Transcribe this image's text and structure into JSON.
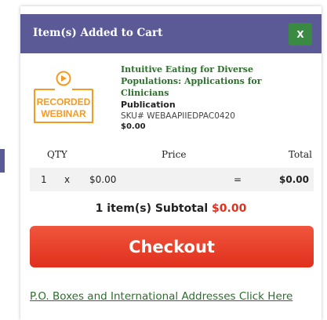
{
  "modal": {
    "title": "Item(s) Added to Cart",
    "close_label": "X"
  },
  "product": {
    "thumbnail_text": [
      "RECORDED",
      "WEBINAR"
    ],
    "thumbnail_icon": "play-circle-icon",
    "title": "Intuitive Eating for Diverse Populations: Applications for Clinicians",
    "type": "Publication",
    "sku": "SKU# WEBAAPIIEDPAC0420",
    "price": "$0.00"
  },
  "cart": {
    "headers": {
      "qty": "QTY",
      "price": "Price",
      "total": "Total"
    },
    "rows": [
      {
        "qty": "1",
        "times": "x",
        "price": "$0.00",
        "equals": "=",
        "total": "$0.00"
      }
    ]
  },
  "subtotal": {
    "label": "1 item(s) Subtotal",
    "amount": "$0.00"
  },
  "checkout_label": "Checkout",
  "po_link": "P.O. Boxes and International Addresses Click Here",
  "colors": {
    "header": "#5b5a96",
    "close_button": "#3a8a44",
    "checkout": "#e0301e",
    "thumbnail_orange": "#f59a23",
    "link_green": "#2d6e2d"
  }
}
